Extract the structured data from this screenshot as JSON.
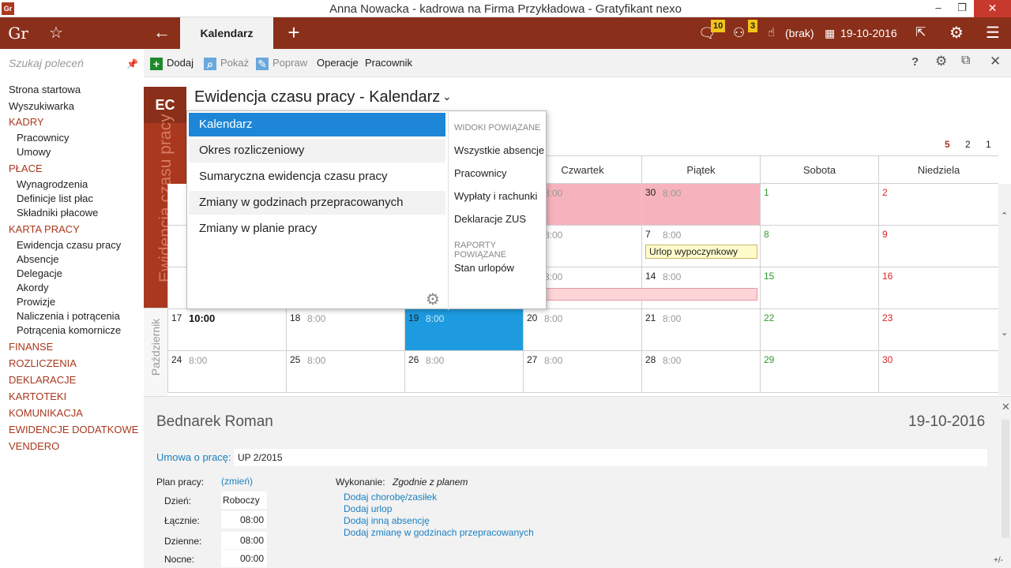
{
  "window": {
    "app_logo": "Gr",
    "title": "Anna Nowacka - kadrowa na Firma Przykładowa - Gratyfikant nexo",
    "minimize": "‒",
    "restore": "❐",
    "close": "✕"
  },
  "topnav": {
    "logo": "Gr",
    "active_tab": "Kalendarz",
    "messages_count": "10",
    "tasks_count": "3",
    "user_status": "(brak)",
    "date": "19-10-2016"
  },
  "sidebar": {
    "search_placeholder": "Szukaj poleceń",
    "items": [
      {
        "label": "Strona startowa",
        "type": "item"
      },
      {
        "label": "Wyszukiwarka",
        "type": "item"
      },
      {
        "label": "KADRY",
        "type": "sec"
      },
      {
        "label": "Pracownicy",
        "type": "sub"
      },
      {
        "label": "Umowy",
        "type": "sub"
      },
      {
        "label": "PŁACE",
        "type": "sec"
      },
      {
        "label": "Wynagrodzenia",
        "type": "sub"
      },
      {
        "label": "Definicje list płac",
        "type": "sub"
      },
      {
        "label": "Składniki płacowe",
        "type": "sub"
      },
      {
        "label": "KARTA PRACY",
        "type": "sec"
      },
      {
        "label": "Ewidencja czasu pracy",
        "type": "sub"
      },
      {
        "label": "Absencje",
        "type": "sub"
      },
      {
        "label": "Delegacje",
        "type": "sub"
      },
      {
        "label": "Akordy",
        "type": "sub"
      },
      {
        "label": "Prowizje",
        "type": "sub"
      },
      {
        "label": "Naliczenia i potrącenia",
        "type": "sub"
      },
      {
        "label": "Potrącenia komornicze",
        "type": "sub"
      },
      {
        "label": "FINANSE",
        "type": "sec"
      },
      {
        "label": "ROZLICZENIA",
        "type": "sec"
      },
      {
        "label": "DEKLARACJE",
        "type": "sec"
      },
      {
        "label": "KARTOTEKI",
        "type": "sec"
      },
      {
        "label": "KOMUNIKACJA",
        "type": "sec"
      },
      {
        "label": "EWIDENCJE DODATKOWE",
        "type": "sec"
      },
      {
        "label": "VENDERO",
        "type": "sec"
      }
    ]
  },
  "toolbar": {
    "add": "Dodaj",
    "show": "Pokaż",
    "edit": "Popraw",
    "operations": "Operacje",
    "employee": "Pracownik",
    "help": "?"
  },
  "view": {
    "badge": "EC",
    "vertical_label": "Ewidencja czasu pracy",
    "title": "Ewidencja czasu pracy - Kalendarz",
    "month_label": "Październik"
  },
  "pager": [
    "5",
    "2",
    "1"
  ],
  "calendar": {
    "headers": [
      "Czwartek",
      "Piątek",
      "Sobota",
      "Niedziela"
    ],
    "rows": [
      [
        {
          "n": "",
          "h": "8:00",
          "pink": true
        },
        {
          "n": "30",
          "h": "8:00",
          "pink": true
        },
        {
          "n": "1",
          "h": ""
        },
        {
          "n": "2",
          "h": ""
        }
      ],
      [
        {
          "n": "",
          "h": "8:00"
        },
        {
          "n": "7",
          "h": "8:00",
          "note": "Urlop wypoczynkowy"
        },
        {
          "n": "8",
          "h": ""
        },
        {
          "n": "9",
          "h": ""
        }
      ],
      [
        {
          "n": "",
          "h": "8:00"
        },
        {
          "n": "14",
          "h": "8:00"
        },
        {
          "n": "15",
          "h": ""
        },
        {
          "n": "16",
          "h": ""
        }
      ]
    ],
    "row4": [
      {
        "n": "17",
        "h": "10:00",
        "bold": true
      },
      {
        "n": "18",
        "h": "8:00"
      },
      {
        "n": "19",
        "h": "8:00",
        "sel": true
      },
      {
        "n": "20",
        "h": "8:00"
      },
      {
        "n": "21",
        "h": "8:00"
      },
      {
        "n": "22",
        "h": ""
      },
      {
        "n": "23",
        "h": ""
      }
    ],
    "row5": [
      {
        "n": "24",
        "h": "8:00"
      },
      {
        "n": "25",
        "h": "8:00"
      },
      {
        "n": "26",
        "h": "8:00"
      },
      {
        "n": "27",
        "h": "8:00"
      },
      {
        "n": "28",
        "h": "8:00"
      },
      {
        "n": "29",
        "h": ""
      },
      {
        "n": "30",
        "h": ""
      }
    ]
  },
  "details": {
    "employee_name": "Bednarek Roman",
    "date": "19-10-2016",
    "contract_label": "Umowa o pracę:",
    "contract_value": "UP 2/2015",
    "plan_label": "Plan pracy:",
    "change_link": "(zmień)",
    "day_label": "Dzień:",
    "day_value": "Roboczy",
    "total_label": "Łącznie:",
    "total_value": "08:00",
    "daytime_label": "Dzienne:",
    "daytime_value": "08:00",
    "night_label": "Nocne:",
    "night_value": "00:00",
    "execution_label": "Wykonanie:",
    "execution_value": "Zgodnie z planem",
    "actions": [
      "Dodaj chorobę/zasiłek",
      "Dodaj urlop",
      "Dodaj inną absencję",
      "Dodaj zmianę w godzinach przepracowanych"
    ],
    "plusminus": "+/-"
  },
  "dropdown": {
    "items": [
      "Kalendarz",
      "Okres rozliczeniowy",
      "Sumaryczna ewidencja czasu pracy",
      "Zmiany w godzinach przepracowanych",
      "Zmiany w planie pracy"
    ],
    "related_views_header": "WIDOKI POWIĄZANE",
    "related_views": [
      "Wszystkie absencje",
      "Pracownicy",
      "Wypłaty i rachunki",
      "Deklaracje ZUS"
    ],
    "related_reports_header": "RAPORTY POWIĄZANE",
    "related_reports": [
      "Stan urlopów"
    ]
  }
}
